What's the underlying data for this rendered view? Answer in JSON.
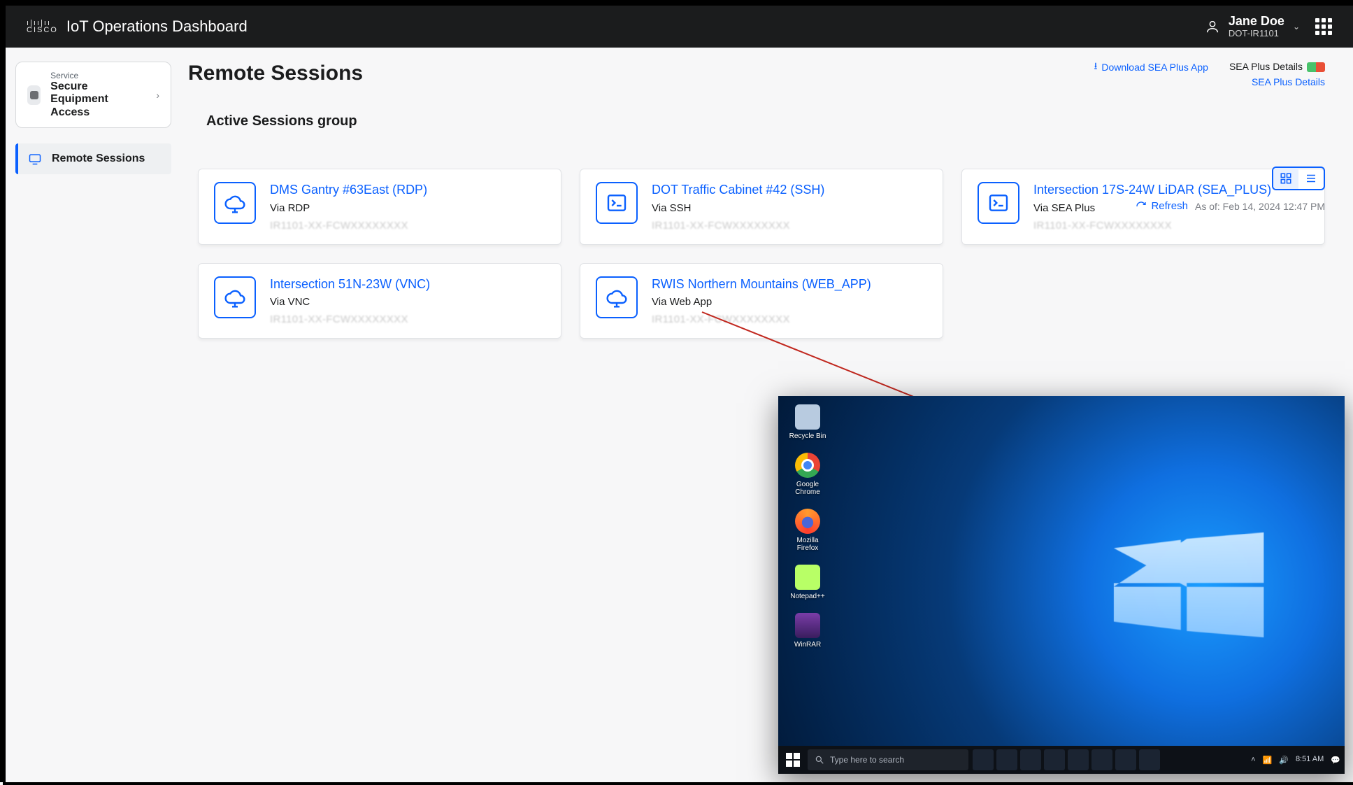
{
  "header": {
    "app_title": "IoT Operations Dashboard",
    "user_name": "Jane Doe",
    "user_org": "DOT-IR1101"
  },
  "sidebar": {
    "service_label": "Service",
    "service_name": "Secure Equipment Access",
    "nav_item": "Remote Sessions"
  },
  "page": {
    "title": "Remote Sessions",
    "download_link": "Download SEA Plus App",
    "details_link_1": "SEA Plus Details",
    "details_link_2": "SEA Plus Details",
    "section_title": "Active Sessions group",
    "refresh": "Refresh",
    "as_of": "As of: Feb 14, 2024 12:47 PM"
  },
  "sessions": [
    {
      "title": "DMS Gantry #63East (RDP)",
      "via": "Via RDP",
      "icon": "cloud"
    },
    {
      "title": "DOT Traffic Cabinet #42 (SSH)",
      "via": "Via SSH",
      "icon": "terminal"
    },
    {
      "title": "Intersection 17S-24W LiDAR (SEA_PLUS)",
      "via": "Via SEA Plus",
      "icon": "terminal"
    },
    {
      "title": "Intersection 51N-23W (VNC)",
      "via": "Via VNC",
      "icon": "cloud"
    },
    {
      "title": "RWIS Northern Mountains (WEB_APP)",
      "via": "Via Web App",
      "icon": "cloud"
    }
  ],
  "desktop": {
    "icons": [
      "Recycle Bin",
      "Google Chrome",
      "Mozilla Firefox",
      "Notepad++",
      "WinRAR"
    ],
    "search_placeholder": "Type here to search",
    "time": "8:51 AM",
    "date": ""
  }
}
